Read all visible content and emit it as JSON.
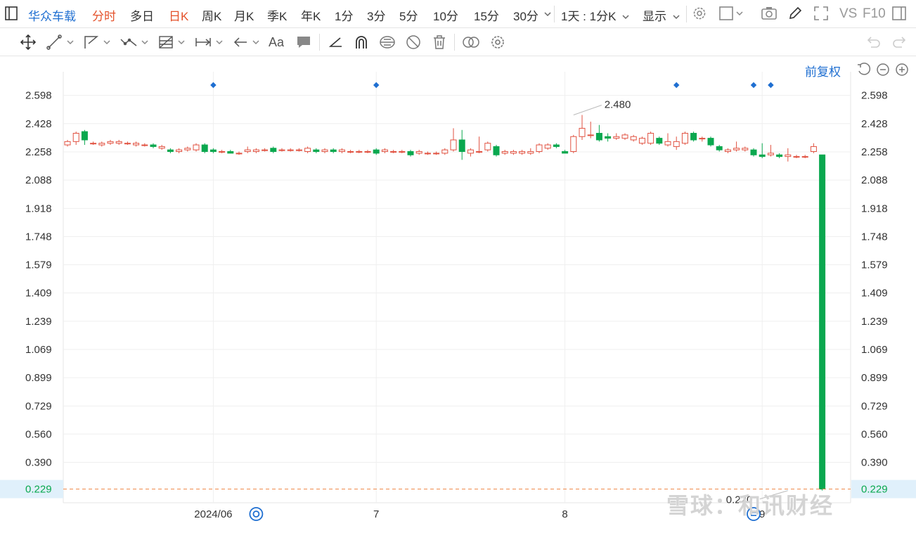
{
  "stock_name": "华众车载",
  "top_tabs": [
    "分时",
    "多日",
    "日K",
    "周K",
    "月K",
    "季K",
    "年K",
    "1分",
    "3分",
    "5分",
    "10分",
    "15分",
    "30分"
  ],
  "active_tab": "日K",
  "period_select": "1天 : 1分K",
  "display_select": "显示",
  "vs_label": "VS",
  "f10_label": "F10",
  "font_tool_label": "Aa",
  "adjust_label": "前复权",
  "watermark": "雪球：和讯财经",
  "colors": {
    "up": "#e15241",
    "down": "#0aa84f",
    "accent": "#1f6fd1",
    "active": "#e4522b",
    "dashed": "#f08a4b"
  },
  "chart_data": {
    "type": "candlestick",
    "y_ticks": [
      "2.598",
      "2.428",
      "2.258",
      "2.088",
      "1.918",
      "1.748",
      "1.579",
      "1.409",
      "1.239",
      "1.069",
      "0.899",
      "0.729",
      "0.560",
      "0.390"
    ],
    "ylim": [
      0.155,
      2.698
    ],
    "x_labels": [
      "2024/06",
      "7",
      "8",
      "9"
    ],
    "x_label_index": [
      17,
      36,
      58,
      81
    ],
    "last_price": "0.229",
    "max_label": "2.480",
    "max_index": 59,
    "min_label": "0.220",
    "min_index": 84,
    "candles": [
      [
        2.3,
        2.32,
        2.33,
        2.29
      ],
      [
        2.32,
        2.37,
        2.38,
        2.3
      ],
      [
        2.38,
        2.33,
        2.39,
        2.3
      ],
      [
        2.31,
        2.31,
        2.32,
        2.3
      ],
      [
        2.3,
        2.31,
        2.32,
        2.29
      ],
      [
        2.31,
        2.32,
        2.33,
        2.3
      ],
      [
        2.31,
        2.32,
        2.33,
        2.3
      ],
      [
        2.31,
        2.31,
        2.32,
        2.3
      ],
      [
        2.3,
        2.31,
        2.32,
        2.29
      ],
      [
        2.3,
        2.3,
        2.31,
        2.29
      ],
      [
        2.3,
        2.29,
        2.31,
        2.28
      ],
      [
        2.28,
        2.29,
        2.3,
        2.27
      ],
      [
        2.27,
        2.26,
        2.28,
        2.25
      ],
      [
        2.26,
        2.27,
        2.28,
        2.25
      ],
      [
        2.27,
        2.28,
        2.29,
        2.26
      ],
      [
        2.27,
        2.3,
        2.31,
        2.26
      ],
      [
        2.3,
        2.26,
        2.31,
        2.25
      ],
      [
        2.27,
        2.26,
        2.28,
        2.25
      ],
      [
        2.26,
        2.26,
        2.27,
        2.25
      ],
      [
        2.26,
        2.25,
        2.27,
        2.25
      ],
      [
        2.25,
        2.25,
        2.26,
        2.24
      ],
      [
        2.26,
        2.27,
        2.29,
        2.25
      ],
      [
        2.26,
        2.27,
        2.28,
        2.25
      ],
      [
        2.27,
        2.27,
        2.28,
        2.26
      ],
      [
        2.28,
        2.26,
        2.29,
        2.25
      ],
      [
        2.27,
        2.27,
        2.28,
        2.26
      ],
      [
        2.27,
        2.27,
        2.28,
        2.26
      ],
      [
        2.27,
        2.27,
        2.28,
        2.26
      ],
      [
        2.26,
        2.28,
        2.29,
        2.25
      ],
      [
        2.27,
        2.26,
        2.28,
        2.25
      ],
      [
        2.26,
        2.27,
        2.28,
        2.25
      ],
      [
        2.27,
        2.26,
        2.28,
        2.25
      ],
      [
        2.26,
        2.27,
        2.28,
        2.25
      ],
      [
        2.26,
        2.26,
        2.27,
        2.25
      ],
      [
        2.26,
        2.26,
        2.27,
        2.25
      ],
      [
        2.26,
        2.26,
        2.27,
        2.25
      ],
      [
        2.27,
        2.25,
        2.28,
        2.24
      ],
      [
        2.26,
        2.27,
        2.28,
        2.25
      ],
      [
        2.26,
        2.26,
        2.27,
        2.25
      ],
      [
        2.26,
        2.26,
        2.27,
        2.25
      ],
      [
        2.26,
        2.24,
        2.27,
        2.23
      ],
      [
        2.25,
        2.26,
        2.27,
        2.24
      ],
      [
        2.25,
        2.25,
        2.26,
        2.24
      ],
      [
        2.25,
        2.25,
        2.26,
        2.24
      ],
      [
        2.25,
        2.27,
        2.28,
        2.24
      ],
      [
        2.27,
        2.33,
        2.4,
        2.26
      ],
      [
        2.33,
        2.26,
        2.39,
        2.21
      ],
      [
        2.25,
        2.27,
        2.28,
        2.23
      ],
      [
        2.26,
        2.26,
        2.35,
        2.25
      ],
      [
        2.27,
        2.31,
        2.32,
        2.26
      ],
      [
        2.29,
        2.24,
        2.3,
        2.23
      ],
      [
        2.25,
        2.26,
        2.27,
        2.24
      ],
      [
        2.25,
        2.26,
        2.27,
        2.24
      ],
      [
        2.25,
        2.26,
        2.27,
        2.24
      ],
      [
        2.25,
        2.26,
        2.28,
        2.24
      ],
      [
        2.26,
        2.3,
        2.31,
        2.25
      ],
      [
        2.28,
        2.3,
        2.31,
        2.27
      ],
      [
        2.3,
        2.29,
        2.31,
        2.28
      ],
      [
        2.26,
        2.25,
        2.27,
        2.25
      ],
      [
        2.26,
        2.35,
        2.36,
        2.25
      ],
      [
        2.35,
        2.4,
        2.48,
        2.33
      ],
      [
        2.36,
        2.36,
        2.44,
        2.34
      ],
      [
        2.37,
        2.33,
        2.42,
        2.32
      ],
      [
        2.35,
        2.34,
        2.37,
        2.32
      ],
      [
        2.34,
        2.35,
        2.37,
        2.33
      ],
      [
        2.34,
        2.36,
        2.37,
        2.33
      ],
      [
        2.33,
        2.35,
        2.36,
        2.32
      ],
      [
        2.31,
        2.34,
        2.35,
        2.3
      ],
      [
        2.31,
        2.37,
        2.38,
        2.3
      ],
      [
        2.34,
        2.31,
        2.35,
        2.3
      ],
      [
        2.3,
        2.32,
        2.37,
        2.29
      ],
      [
        2.29,
        2.32,
        2.35,
        2.27
      ],
      [
        2.31,
        2.37,
        2.38,
        2.3
      ],
      [
        2.37,
        2.33,
        2.38,
        2.32
      ],
      [
        2.34,
        2.34,
        2.35,
        2.32
      ],
      [
        2.34,
        2.3,
        2.35,
        2.29
      ],
      [
        2.29,
        2.27,
        2.3,
        2.26
      ],
      [
        2.26,
        2.27,
        2.28,
        2.25
      ],
      [
        2.27,
        2.28,
        2.32,
        2.26
      ],
      [
        2.27,
        2.28,
        2.29,
        2.26
      ],
      [
        2.27,
        2.24,
        2.28,
        2.23
      ],
      [
        2.24,
        2.23,
        2.31,
        2.22
      ],
      [
        2.24,
        2.25,
        2.3,
        2.23
      ],
      [
        2.24,
        2.23,
        2.25,
        2.22
      ],
      [
        2.23,
        2.24,
        2.28,
        2.2
      ],
      [
        2.23,
        2.23,
        2.24,
        2.22
      ],
      [
        2.23,
        2.23,
        2.24,
        2.22
      ],
      [
        2.26,
        2.29,
        2.31,
        2.25
      ],
      [
        2.24,
        0.229,
        2.24,
        0.22
      ]
    ]
  }
}
